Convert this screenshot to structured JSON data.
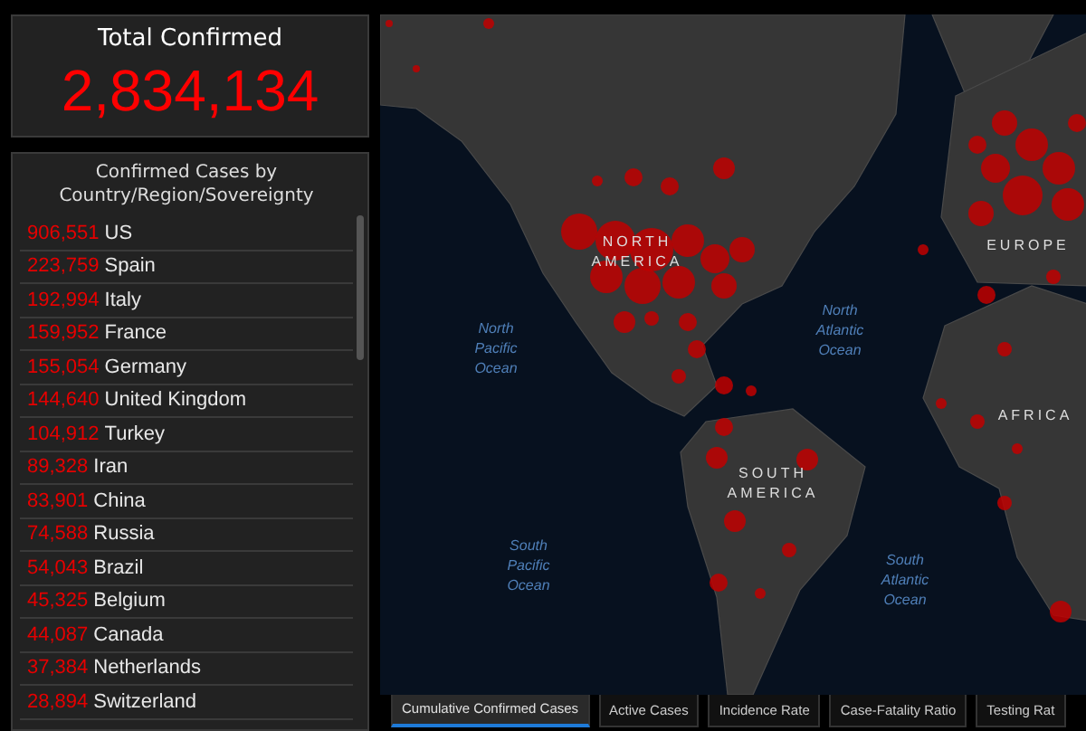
{
  "total": {
    "title": "Total Confirmed",
    "value": "2,834,134"
  },
  "country_list": {
    "title": "Confirmed Cases by Country/Region/Sovereignty",
    "rows": [
      {
        "count": "906,551",
        "name": "US"
      },
      {
        "count": "223,759",
        "name": "Spain"
      },
      {
        "count": "192,994",
        "name": "Italy"
      },
      {
        "count": "159,952",
        "name": "France"
      },
      {
        "count": "155,054",
        "name": "Germany"
      },
      {
        "count": "144,640",
        "name": "United Kingdom"
      },
      {
        "count": "104,912",
        "name": "Turkey"
      },
      {
        "count": "89,328",
        "name": "Iran"
      },
      {
        "count": "83,901",
        "name": "China"
      },
      {
        "count": "74,588",
        "name": "Russia"
      },
      {
        "count": "54,043",
        "name": "Brazil"
      },
      {
        "count": "45,325",
        "name": "Belgium"
      },
      {
        "count": "44,087",
        "name": "Canada"
      },
      {
        "count": "37,384",
        "name": "Netherlands"
      },
      {
        "count": "28,894",
        "name": "Switzerland"
      }
    ]
  },
  "map": {
    "labels": [
      {
        "kind": "continent",
        "text": "NORTH AMERICA"
      },
      {
        "kind": "continent",
        "text": "EUROPE"
      },
      {
        "kind": "ocean",
        "text": "North Pacific Ocean"
      },
      {
        "kind": "ocean",
        "text": "North Atlantic Ocean"
      },
      {
        "kind": "continent",
        "text": "AFRICA"
      },
      {
        "kind": "continent",
        "text": "SOUTH AMERICA"
      },
      {
        "kind": "ocean",
        "text": "South Pacific Ocean"
      },
      {
        "kind": "ocean",
        "text": "South Atlantic Ocean"
      }
    ]
  },
  "tabs": [
    {
      "label": "Cumulative Confirmed Cases",
      "selected": true
    },
    {
      "label": "Active Cases",
      "selected": false
    },
    {
      "label": "Incidence Rate",
      "selected": false
    },
    {
      "label": "Case-Fatality Ratio",
      "selected": false
    },
    {
      "label": "Testing Rat",
      "selected": false
    }
  ]
}
